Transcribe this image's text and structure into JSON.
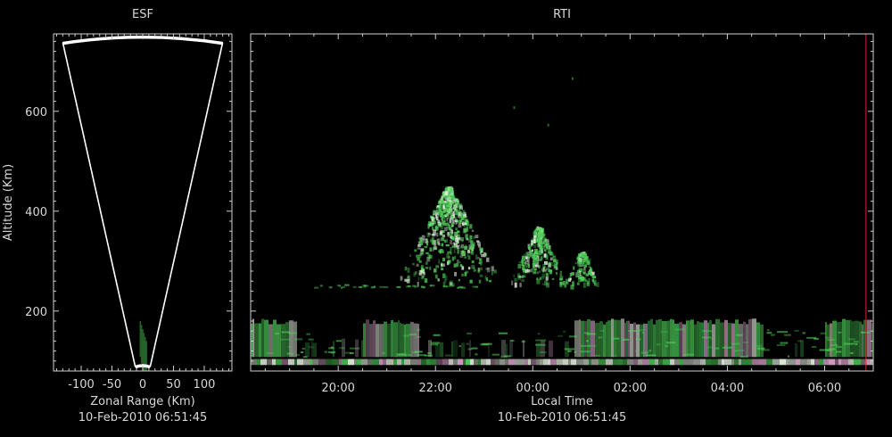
{
  "colors": {
    "background": "#000000",
    "axis": "#cfcfcf",
    "text": "#d8d8d8",
    "fan": "#ffffff",
    "marker": "#c03030",
    "echo_green": "#4fd05a",
    "echo_white": "#e6f0e0",
    "echo_pink": "#d8a0c8"
  },
  "chart_data": [
    {
      "type": "fan",
      "title": "ESF",
      "xlabel": "Zonal Range (Km)",
      "ylabel": "Altitude (Km)",
      "xticks": [
        -100,
        -50,
        0,
        50,
        100
      ],
      "yticks": [
        200,
        400,
        600
      ],
      "xlim": [
        -145,
        145
      ],
      "ylim": [
        80,
        755
      ],
      "fan": {
        "half_width_km": 130,
        "min_alt_km": 88,
        "max_alt_km": 745
      },
      "timestamp": "10-Feb-2010 06:51:45"
    },
    {
      "type": "heatmap",
      "title": "RTI",
      "xlabel": "Local Time",
      "ylabel": "Altitude (Km)",
      "xticks": [
        "20:00",
        "22:00",
        "00:00",
        "02:00",
        "04:00",
        "06:00"
      ],
      "yticks": [
        200,
        400,
        600
      ],
      "xlim_hours": [
        18.2,
        31.0
      ],
      "ylim": [
        80,
        755
      ],
      "marker_hour": 30.85,
      "timestamp": "10-Feb-2010 06:51:45"
    }
  ]
}
